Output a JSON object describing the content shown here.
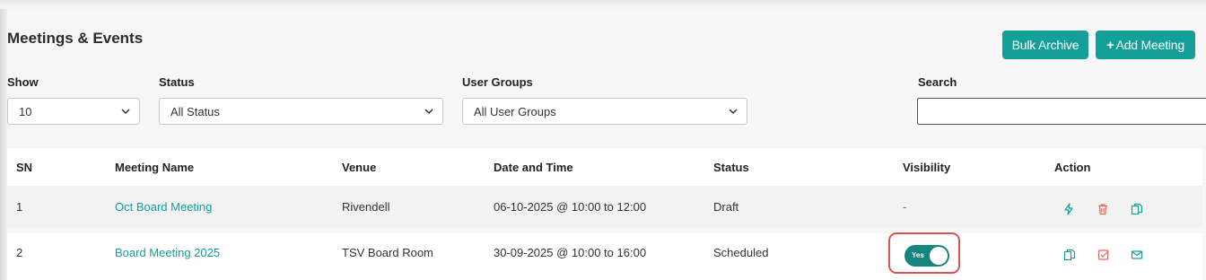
{
  "page": {
    "title": "Meetings & Events",
    "bulk_archive_label": "Bulk Archive",
    "add_meeting_label": "Add Meeting",
    "add_icon_glyph": "+"
  },
  "filters": {
    "show": {
      "label": "Show",
      "value": "10"
    },
    "status": {
      "label": "Status",
      "value": "All Status"
    },
    "user_groups": {
      "label": "User Groups",
      "value": "All User Groups"
    },
    "search": {
      "label": "Search",
      "value": ""
    }
  },
  "table": {
    "headers": [
      "SN",
      "Meeting Name",
      "Venue",
      "Date and Time",
      "Status",
      "Visibility",
      "Action"
    ],
    "rows": [
      {
        "sn": "1",
        "meeting_name": "Oct Board Meeting",
        "venue": "Rivendell",
        "date_time": "06-10-2025 @ 10:00 to 12:00",
        "status": "Draft",
        "visibility": "-",
        "actions": [
          "lightning-icon",
          "trash-icon",
          "copy-icon"
        ]
      },
      {
        "sn": "2",
        "meeting_name": "Board Meeting 2025",
        "venue": "TSV Board Room",
        "date_time": "30-09-2025 @ 10:00 to 16:00",
        "status": "Scheduled",
        "visibility": "Yes",
        "visibility_on": true,
        "actions": [
          "copy-icon",
          "checkbox-edit-icon",
          "mail-icon"
        ]
      }
    ]
  },
  "colors": {
    "accent": "#14a099",
    "toggle_on": "#14867f",
    "danger": "#e36a5a",
    "highlight_box": "#d9534f"
  }
}
